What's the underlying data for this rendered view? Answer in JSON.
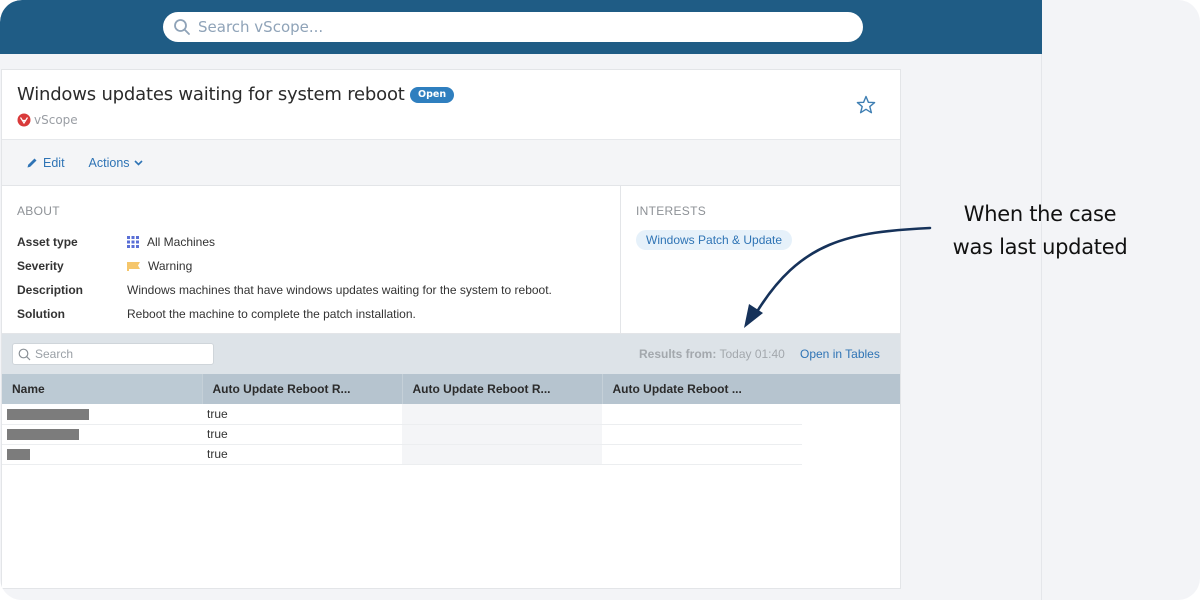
{
  "search": {
    "placeholder": "Search vScope..."
  },
  "case": {
    "title": "Windows updates waiting for system reboot",
    "status": "Open",
    "source": "vScope"
  },
  "toolbar": {
    "edit_label": "Edit",
    "actions_label": "Actions"
  },
  "about": {
    "heading": "ABOUT",
    "fields": [
      {
        "label": "Asset type",
        "value": "All Machines",
        "icon": "grid-icon"
      },
      {
        "label": "Severity",
        "value": "Warning",
        "icon": "flag-icon"
      },
      {
        "label": "Description",
        "value": "Windows machines that have windows updates waiting for the system to reboot."
      },
      {
        "label": "Solution",
        "value": "Reboot the machine to complete the patch installation."
      }
    ]
  },
  "interests": {
    "heading": "INTERESTS",
    "chips": [
      "Windows Patch & Update"
    ]
  },
  "results": {
    "search_placeholder": "Search",
    "results_from_label": "Results from:",
    "results_from_value": "Today 01:40",
    "open_in_tables": "Open in Tables",
    "columns": [
      "Name",
      "Auto Update Reboot R...",
      "Auto Update Reboot R...",
      "Auto Update Reboot ..."
    ],
    "rows": [
      {
        "name": "[redacted]",
        "col2": "true",
        "col3": "",
        "col4": ""
      },
      {
        "name": "[redacted]",
        "col2": "true",
        "col3": "",
        "col4": ""
      },
      {
        "name": "[redacted]",
        "col2": "true",
        "col3": "",
        "col4": ""
      }
    ]
  },
  "annotation": {
    "line1": "When the case",
    "line2": "was last updated"
  },
  "colors": {
    "topbar": "#1f5c85",
    "accent": "#2f74b5",
    "badge": "#2f7fbf",
    "warning": "#f5c66b",
    "brand_red": "#d93a3a"
  }
}
